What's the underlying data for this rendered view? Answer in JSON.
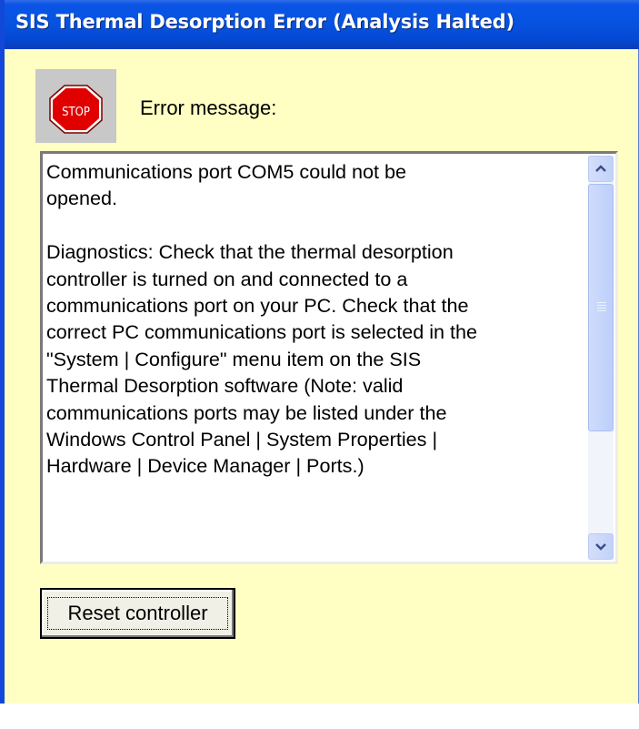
{
  "window": {
    "title": "SIS Thermal Desorption Error (Analysis Halted)"
  },
  "icon": {
    "name": "stop-sign-icon",
    "text": "STOP",
    "color": "#e00000"
  },
  "error_label": "Error message:",
  "message": {
    "text": "Communications port COM5 could not be\nopened.\n\nDiagnostics: Check that the thermal desorption\ncontroller is turned on and connected to a\ncommunications port on your PC.  Check that the\ncorrect PC communications port is selected in the\n\"System | Configure\" menu item on the SIS\nThermal Desorption software (Note: valid\ncommunications ports may be listed under the\nWindows Control Panel | System Properties |\nHardware | Device Manager | Ports.)"
  },
  "buttons": {
    "reset": "Reset controller"
  },
  "colors": {
    "titlebar": "#0653e0",
    "background": "#ffffc4",
    "scrollbar": "#c2d2f8"
  }
}
